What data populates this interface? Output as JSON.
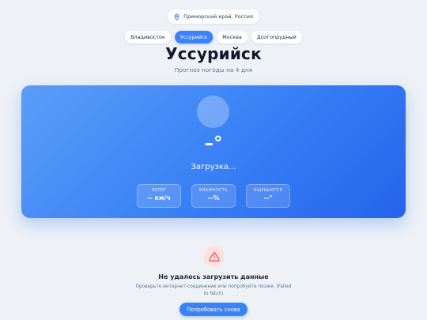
{
  "region": {
    "icon": "map-pin-icon",
    "label": "Приморский край, Россия"
  },
  "tabs": [
    {
      "label": "Владивосток",
      "active": false
    },
    {
      "label": "Уссурийск",
      "active": true
    },
    {
      "label": "Москва",
      "active": false
    },
    {
      "label": "Долгопрудный",
      "active": false
    }
  ],
  "header": {
    "title": "Уссурийск",
    "subtitle": "Прогноз погоды на 4 дня"
  },
  "current": {
    "weather_icon": "weather-placeholder-icon",
    "temperature": "–°",
    "status": "Загрузка...",
    "stats": [
      {
        "label": "Ветер",
        "value": "-- км/ч"
      },
      {
        "label": "Влажность",
        "value": "--%"
      },
      {
        "label": "Ощущается",
        "value": "--°"
      }
    ]
  },
  "error": {
    "icon": "warning-triangle-icon",
    "title": "Не удалось загрузить данные",
    "message": "Проверьте интернет-соединение или попробуйте позже. (Failed to fetch)",
    "retry_label": "Попробовать снова"
  },
  "colors": {
    "accent": "#3b82f6",
    "background": "#eef2f7",
    "error": "#ef4444",
    "error_bg": "#fde2e2"
  }
}
